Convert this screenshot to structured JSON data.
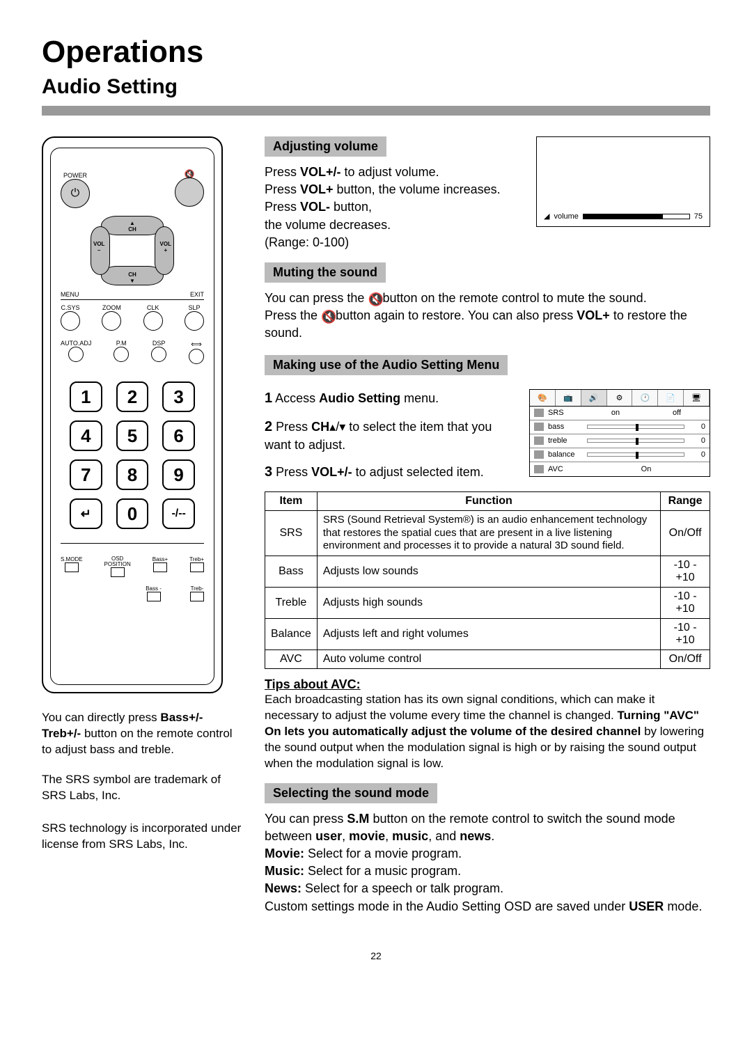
{
  "page": {
    "title": "Operations",
    "subtitle": "Audio Setting",
    "number": "22"
  },
  "remote": {
    "power_label": "POWER",
    "dpad": {
      "ch_up": "CH",
      "ch_down": "CH",
      "vol_minus": "VOL\n–",
      "vol_plus": "VOL\n+"
    },
    "menu": "MENU",
    "exit": "EXIT",
    "row_a": [
      "C.SYS",
      "ZOOM",
      "CLK",
      "SLP"
    ],
    "row_b": [
      "AUTO.ADJ",
      "P.M",
      "DSP",
      ""
    ],
    "keypad": [
      "1",
      "2",
      "3",
      "4",
      "5",
      "6",
      "7",
      "8",
      "9",
      "↵",
      "0",
      "-/--"
    ],
    "row_c": [
      "S.MODE",
      "OSD\nPOSITION",
      "Bass+",
      "Treb+"
    ],
    "row_d": [
      "",
      "",
      "Bass -",
      "Treb-"
    ]
  },
  "left_notes": {
    "n1_a": "You can directly press ",
    "n1_b": "Bass+/- Treb+/-",
    "n1_c": " button on the remote control to adjust bass and treble.",
    "n2": "The SRS symbol are trademark of SRS Labs, Inc.",
    "n3": "SRS technology is incorporated under license from SRS Labs, Inc."
  },
  "sections": {
    "adjusting_volume": {
      "heading": "Adjusting volume",
      "l1": "Press ",
      "l1b": "VOL+/-",
      "l1c": " to adjust volume.",
      "l2a": "Press ",
      "l2b": "VOL+",
      "l2c": " button, the volume increases. Press ",
      "l2d": "VOL-",
      "l2e": " button,",
      "l3": "the volume decreases.",
      "l4": "(Range: 0-100)",
      "osd_label": "volume",
      "osd_value": "75"
    },
    "muting": {
      "heading": "Muting the sound",
      "p1a": "You can press the ",
      "p1b": " button on the remote control to mute the sound.",
      "p2a": "Press the ",
      "p2b": " button again to restore. You can also press ",
      "p2c": "VOL+",
      "p2d": " to restore the sound."
    },
    "menu": {
      "heading": "Making use of the Audio Setting Menu",
      "step1a": "Access ",
      "step1b": "Audio Setting",
      "step1c": " menu.",
      "step2a": "Press ",
      "step2b": "CH",
      "step2c": " to select the item that you want to adjust.",
      "step3a": "Press ",
      "step3b": "VOL+/-",
      "step3c": " to adjust selected item.",
      "osd": {
        "tabs": [
          "",
          "",
          "",
          "",
          "",
          "",
          "",
          ""
        ],
        "rows": [
          {
            "label": "SRS",
            "left": "on",
            "right": "off",
            "type": "onoff"
          },
          {
            "label": "bass",
            "val": "0",
            "type": "slider"
          },
          {
            "label": "treble",
            "val": "0",
            "type": "slider"
          },
          {
            "label": "balance",
            "val": "0",
            "type": "slider"
          },
          {
            "label": "AVC",
            "center": "On",
            "type": "center"
          }
        ]
      },
      "table": {
        "headers": [
          "Item",
          "Function",
          "Range"
        ],
        "rows": [
          {
            "item": "SRS",
            "func": "SRS (Sound Retrieval System®) is an audio enhancement technology that restores the spatial cues that are present in a live listening environment and processes it to provide a natural 3D sound field.",
            "range": "On/Off"
          },
          {
            "item": "Bass",
            "func": "Adjusts low sounds",
            "range": "-10 - +10"
          },
          {
            "item": "Treble",
            "func": "Adjusts high sounds",
            "range": "-10 - +10"
          },
          {
            "item": "Balance",
            "func": "Adjusts left and right volumes",
            "range": "-10 - +10"
          },
          {
            "item": "AVC",
            "func": "Auto volume control",
            "range": "On/Off"
          }
        ]
      },
      "tips_heading": "Tips about AVC:",
      "tips_a": "Each broadcasting station has its own signal conditions, which can make it necessary to adjust the volume every time the channel is changed. ",
      "tips_b": "Turning \"AVC\" On lets you automatically adjust the volume of the desired channel",
      "tips_c": " by lowering the sound output when the modulation signal is high or by raising the sound output when the modulation signal is low."
    },
    "sound_mode": {
      "heading": "Selecting the sound mode",
      "l1a": "You can press ",
      "l1b": "S.M",
      "l1c": " button on the remote control to switch the sound mode between ",
      "l1d": "user",
      "l1e": ", ",
      "l1f": "movie",
      "l1g": ", ",
      "l1h": "music",
      "l1i": ", and ",
      "l1j": "news",
      "l1k": ".",
      "movie_a": "Movie:",
      "movie_b": " Select for a movie program.",
      "music_a": "Music:",
      "music_b": " Select for a music program.",
      "news_a": "News:",
      "news_b": " Select for a speech or talk program.",
      "custom_a": "Custom settings mode in the Audio Setting OSD are saved under ",
      "custom_b": "USER",
      "custom_c": " mode."
    }
  }
}
